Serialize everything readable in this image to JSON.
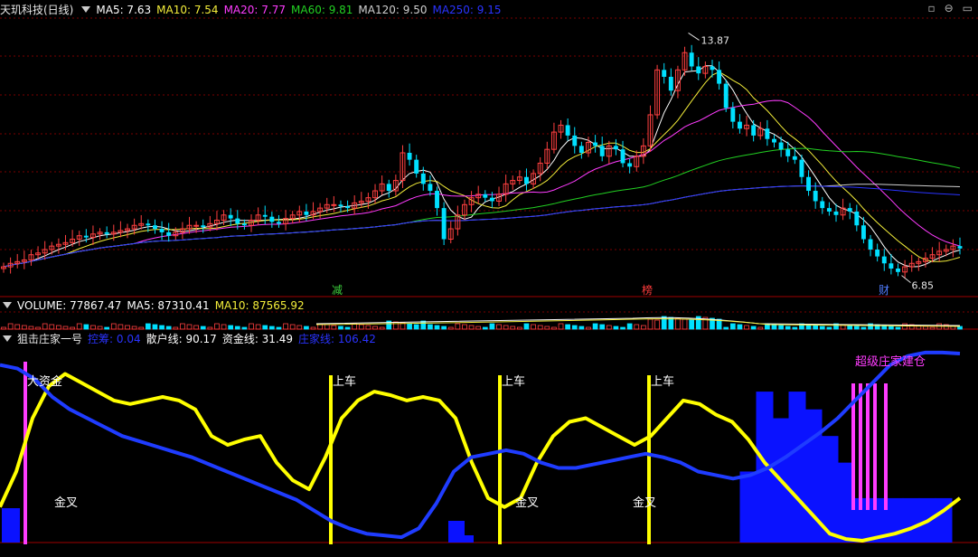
{
  "panels": {
    "main": {
      "title": "天玑科技(日线)",
      "ma": [
        {
          "label": "MA5: 7.63",
          "color": "#ffffff"
        },
        {
          "label": "MA10: 7.54",
          "color": "#f4ee3a"
        },
        {
          "label": "MA20: 7.77",
          "color": "#ff3cff"
        },
        {
          "label": "MA60: 9.81",
          "color": "#22d022"
        },
        {
          "label": "MA120: 9.50",
          "color": "#cfcfcf"
        },
        {
          "label": "MA250: 9.15",
          "color": "#2a33ff"
        }
      ],
      "high_label": "13.87",
      "low_label": "6.85",
      "markers": [
        {
          "text": "减",
          "color": "#3dd13d"
        },
        {
          "text": "榜",
          "color": "#ff3c3c"
        },
        {
          "text": "财",
          "color": "#4f7cff"
        }
      ]
    },
    "volume": {
      "items": [
        {
          "label": "VOLUME: 77867.47",
          "color": "#ffffff"
        },
        {
          "label": "MA5: 87310.41",
          "color": "#ffffff"
        },
        {
          "label": "MA10: 87565.92",
          "color": "#f4ee3a"
        }
      ]
    },
    "indicator": {
      "title": "狙击庄家一号",
      "items": [
        {
          "label": "控筹: 0.04",
          "color": "#2a33ff"
        },
        {
          "label": "散户线: 90.17",
          "color": "#ffffff"
        },
        {
          "label": "资金线: 31.49",
          "color": "#ffffff"
        },
        {
          "label": "庄家线: 106.42",
          "color": "#2a33ff"
        }
      ],
      "annotations": [
        {
          "text": "大资金",
          "color": "#ffffff"
        },
        {
          "text": "上车",
          "color": "#ffffff"
        },
        {
          "text": "上车",
          "color": "#ffffff"
        },
        {
          "text": "上车",
          "color": "#ffffff"
        },
        {
          "text": "金叉",
          "color": "#ffffff"
        },
        {
          "text": "金叉",
          "color": "#ffffff"
        },
        {
          "text": "金叉",
          "color": "#ffffff"
        },
        {
          "text": "超级庄家建仓",
          "color": "#ff3cff"
        }
      ]
    }
  },
  "window_controls": [
    "▫",
    "⊖",
    "▭"
  ],
  "colors": {
    "up": "#ff4040",
    "down": "#00e0ff",
    "grid": "#7a0000",
    "bg": "#000000"
  },
  "chart_data": [
    {
      "type": "candlestick",
      "title": "天玑科技(日线)",
      "price_range": [
        6.5,
        14.3
      ],
      "high": 13.87,
      "low": 6.85,
      "close_path": [
        7.1,
        7.2,
        7.25,
        7.3,
        7.45,
        7.5,
        7.6,
        7.7,
        7.75,
        7.8,
        7.9,
        8.0,
        7.95,
        8.05,
        8.1,
        8.05,
        8.1,
        8.15,
        8.2,
        8.3,
        8.35,
        8.3,
        8.2,
        8.1,
        8.0,
        8.1,
        8.2,
        8.3,
        8.3,
        8.25,
        8.35,
        8.45,
        8.6,
        8.5,
        8.35,
        8.3,
        8.45,
        8.6,
        8.55,
        8.4,
        8.35,
        8.5,
        8.6,
        8.7,
        8.6,
        8.7,
        8.8,
        8.9,
        8.9,
        8.85,
        8.8,
        8.95,
        9.0,
        9.1,
        9.3,
        9.5,
        9.3,
        9.6,
        10.4,
        10.2,
        9.8,
        9.5,
        9.3,
        8.8,
        7.9,
        8.2,
        8.6,
        8.9,
        9.1,
        9.2,
        9.1,
        9.0,
        9.2,
        9.5,
        9.6,
        9.7,
        9.5,
        9.8,
        10.1,
        10.5,
        11.0,
        11.2,
        10.9,
        10.6,
        10.4,
        10.7,
        10.6,
        10.3,
        10.6,
        10.5,
        10.1,
        10.0,
        10.3,
        10.6,
        11.5,
        12.8,
        12.6,
        12.2,
        12.8,
        13.3,
        12.9,
        12.7,
        12.9,
        12.8,
        12.4,
        11.7,
        11.3,
        11.1,
        11.2,
        10.9,
        11.1,
        10.8,
        10.7,
        10.5,
        10.3,
        10.2,
        9.7,
        9.3,
        9.0,
        8.8,
        8.7,
        8.6,
        8.8,
        8.7,
        8.3,
        7.9,
        7.6,
        7.4,
        7.2,
        7.05,
        6.95,
        7.1,
        7.2,
        7.25,
        7.35,
        7.45,
        7.55,
        7.6,
        7.7,
        7.63
      ]
    },
    {
      "type": "line",
      "title": "狙击庄家一号",
      "y_range": [
        0,
        110
      ],
      "series": [
        {
          "name": "散户线",
          "color": "#ffff00",
          "values": [
            20,
            40,
            70,
            88,
            95,
            90,
            85,
            80,
            78,
            80,
            82,
            80,
            75,
            60,
            55,
            58,
            60,
            45,
            35,
            30,
            48,
            70,
            80,
            85,
            83,
            80,
            82,
            80,
            70,
            45,
            25,
            20,
            25,
            45,
            60,
            68,
            70,
            65,
            60,
            55,
            60,
            70,
            80,
            78,
            72,
            68,
            58,
            45,
            35,
            25,
            15,
            5,
            2,
            1,
            3,
            5,
            8,
            12,
            18,
            25
          ]
        },
        {
          "name": "庄家线",
          "color": "#1f3cff",
          "values": [
            100,
            98,
            92,
            82,
            75,
            70,
            65,
            60,
            57,
            54,
            51,
            48,
            44,
            40,
            36,
            32,
            28,
            24,
            18,
            12,
            8,
            5,
            4,
            3,
            8,
            22,
            40,
            48,
            50,
            52,
            50,
            45,
            42,
            42,
            44,
            46,
            48,
            50,
            48,
            45,
            40,
            38,
            36,
            38,
            42,
            48,
            55,
            62,
            70,
            80,
            90,
            100,
            105,
            107,
            107,
            106.42
          ]
        },
        {
          "name": "控筹",
          "color": "#0a12ff",
          "values": [
            0,
            0,
            0,
            0,
            0,
            0,
            0,
            0,
            0,
            0,
            0,
            0,
            0,
            0,
            0,
            0,
            0,
            0,
            0,
            0,
            0,
            0,
            0,
            0,
            0,
            0,
            0,
            0,
            0,
            0,
            0,
            0,
            0,
            0,
            0,
            0,
            0,
            0,
            0,
            0,
            0,
            0,
            0,
            0,
            0,
            0,
            40,
            85,
            70,
            85,
            75,
            60,
            45,
            25,
            25,
            25,
            25,
            25,
            25,
            0.04
          ]
        }
      ]
    }
  ]
}
